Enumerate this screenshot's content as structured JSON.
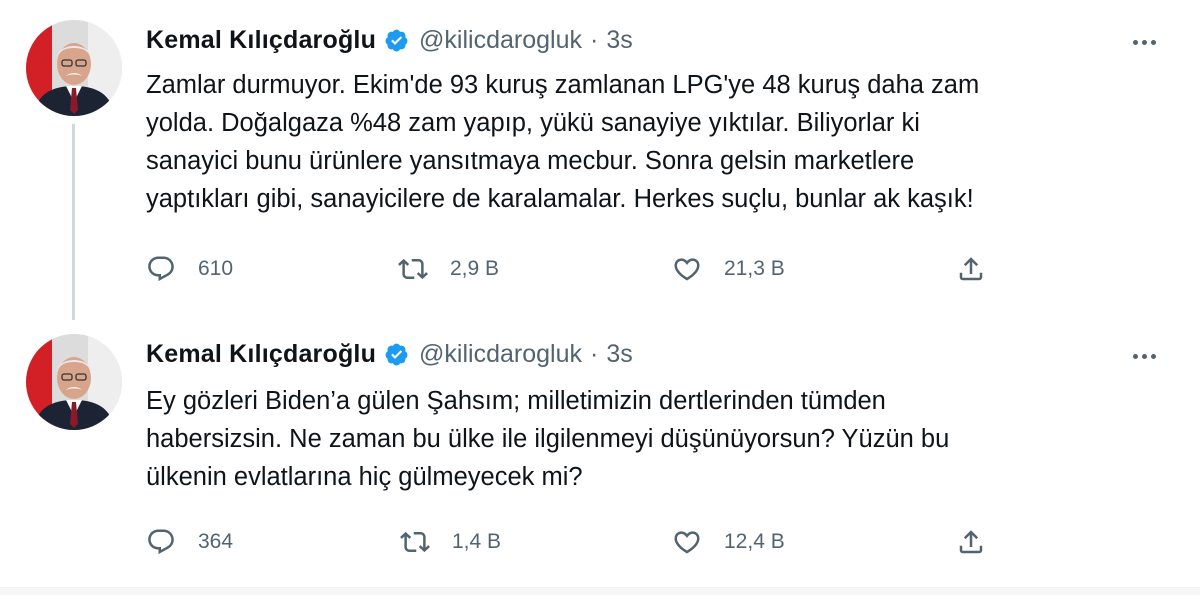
{
  "tweets": [
    {
      "author_name": "Kemal Kılıçdaroğlu",
      "handle": "@kilicdarogluk",
      "separator": "·",
      "time": "3s",
      "text": "Zamlar durmuyor. Ekim'de 93 kuruş zamlanan LPG'ye 48 kuruş daha zam\nyolda. Doğalgaza %48 zam yapıp, yükü sanayiye yıktılar. Biliyorlar ki\nsanayici bunu ürünlere yansıtmaya mecbur. Sonra gelsin marketlere\nyaptıkları gibi, sanayicilere de karalamalar. Herkes suçlu, bunlar ak kaşık!",
      "replies": "610",
      "retweets": "2,9 B",
      "likes": "21,3 B"
    },
    {
      "author_name": "Kemal Kılıçdaroğlu",
      "handle": "@kilicdarogluk",
      "separator": "·",
      "time": "3s",
      "text": "Ey gözleri Biden’a gülen Şahsım; milletimizin dertlerinden tümden\nhabersizsin. Ne zaman bu ülke ile ilgilenmeyi düşünüyorsun? Yüzün bu\nülkenin evlatlarına hiç gülmeyecek mi?",
      "replies": "364",
      "retweets": "1,4 B",
      "likes": "12,4 B"
    }
  ],
  "icons": {
    "verified": "verified-badge-icon",
    "more": "more-options-icon",
    "reply": "reply-icon",
    "retweet": "retweet-icon",
    "like": "like-icon",
    "share": "share-icon"
  },
  "colors": {
    "verified_blue": "#1d9bf0",
    "text_primary": "#0f1419",
    "text_secondary": "#536471",
    "thread_line": "#cfd9de"
  }
}
